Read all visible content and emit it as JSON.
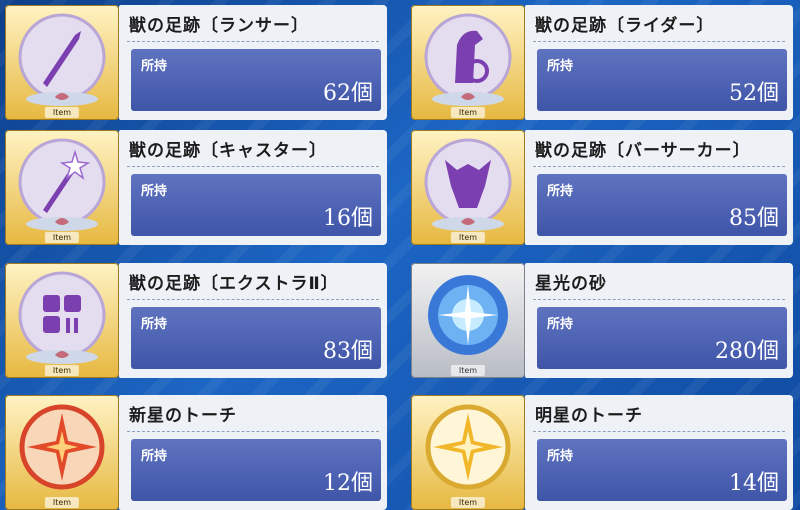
{
  "items": [
    {
      "name": "獣の足跡〔ランサー〕",
      "owned_label": "所持",
      "count": "62個",
      "tag": "Item",
      "frame": "gold",
      "icon": "spear-icon"
    },
    {
      "name": "獣の足跡〔ライダー〕",
      "owned_label": "所持",
      "count": "52個",
      "tag": "Item",
      "frame": "gold",
      "icon": "horse-icon"
    },
    {
      "name": "獣の足跡〔キャスター〕",
      "owned_label": "所持",
      "count": "16個",
      "tag": "Item",
      "frame": "gold",
      "icon": "staff-icon"
    },
    {
      "name": "獣の足跡〔バーサーカー〕",
      "owned_label": "所持",
      "count": "85個",
      "tag": "Item",
      "frame": "gold",
      "icon": "beast-icon"
    },
    {
      "name": "獣の足跡〔エクストラⅡ〕",
      "owned_label": "所持",
      "count": "83個",
      "tag": "Item",
      "frame": "gold",
      "icon": "extra-icon"
    },
    {
      "name": "星光の砂",
      "owned_label": "所持",
      "count": "280個",
      "tag": "Item",
      "frame": "silver",
      "icon": "star-sand-icon"
    },
    {
      "name": "新星のトーチ",
      "owned_label": "所持",
      "count": "12個",
      "tag": "Item",
      "frame": "gold",
      "icon": "red-torch-icon"
    },
    {
      "name": "明星のトーチ",
      "owned_label": "所持",
      "count": "14個",
      "tag": "Item",
      "frame": "gold",
      "icon": "gold-torch-icon"
    }
  ],
  "colors": {
    "count_bar": "#4a5fb4",
    "panel": "#eef2f7",
    "gold_frame": "#e6b840"
  }
}
